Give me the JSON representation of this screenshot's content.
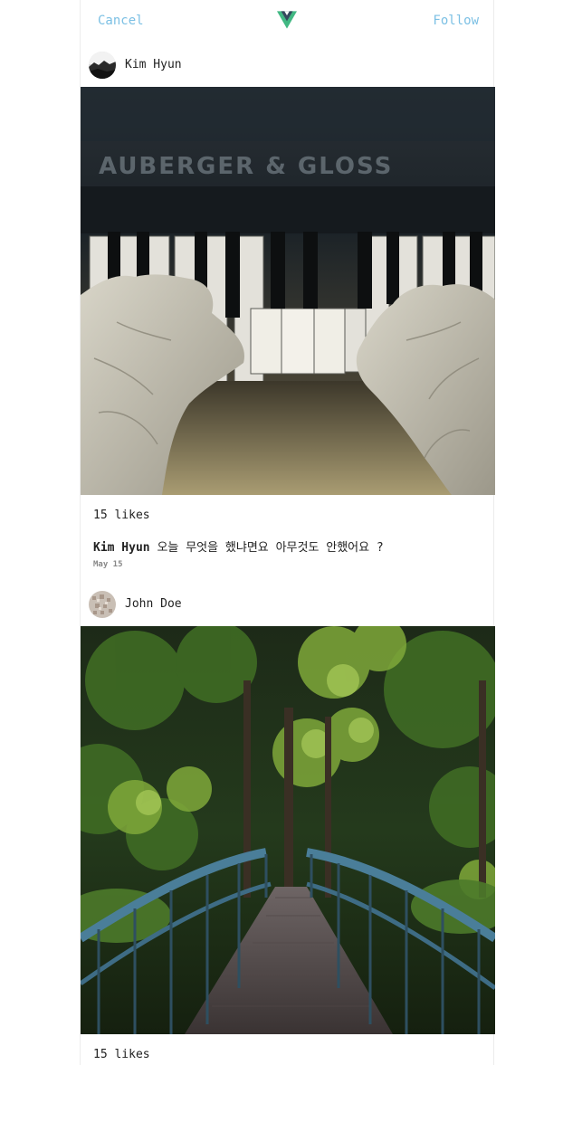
{
  "header": {
    "cancel_label": "Cancel",
    "follow_label": "Follow",
    "logo_icon": "vue-logo-icon",
    "accent_color": "#7cc0e4",
    "logo_colors": [
      "#41b883",
      "#35495e"
    ]
  },
  "posts": [
    {
      "username": "Kim Hyun",
      "avatar_icon": "landscape-avatar",
      "image": "piano-hands-photo",
      "likes": "15 likes",
      "caption_user": "Kim Hyun",
      "caption_text": "오늘 무엇을 했냐면요 아무것도 안했어요 ?",
      "date": "May 15"
    },
    {
      "username": "John Doe",
      "avatar_icon": "pattern-avatar",
      "image": "forest-bridge-photo",
      "likes": "15 likes"
    }
  ]
}
